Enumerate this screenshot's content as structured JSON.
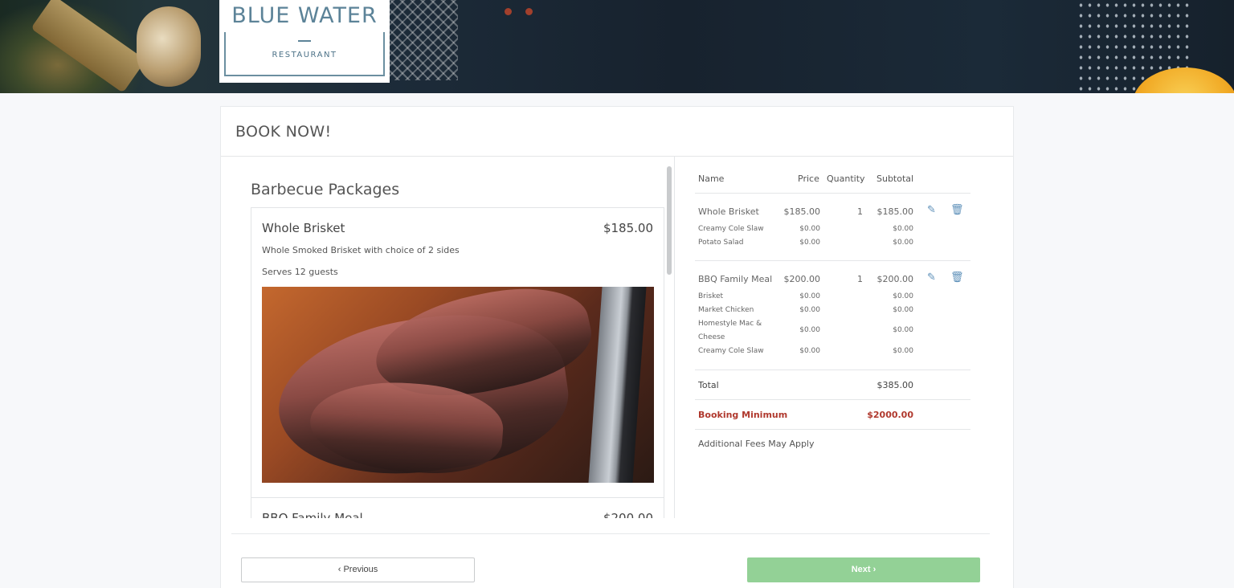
{
  "brand": {
    "logo_title": "BLUE WATER",
    "logo_subtitle": "RESTAURANT"
  },
  "page": {
    "title": "BOOK NOW!"
  },
  "menu": {
    "section_title": "Barbecue Packages",
    "packages": [
      {
        "name": "Whole Brisket",
        "price": "$185.00",
        "description": "Whole Smoked Brisket with choice of 2 sides",
        "serves": "Serves 12 guests",
        "image": "brisket-photo"
      },
      {
        "name": "BBQ Family Meal",
        "price": "$200.00"
      }
    ]
  },
  "cart": {
    "headers": {
      "name": "Name",
      "price": "Price",
      "quantity": "Quantity",
      "subtotal": "Subtotal"
    },
    "items": [
      {
        "name": "Whole Brisket",
        "price": "$185.00",
        "quantity": "1",
        "subtotal": "$185.00",
        "options": [
          {
            "name": "Creamy Cole Slaw",
            "price": "$0.00",
            "subtotal": "$0.00"
          },
          {
            "name": "Potato Salad",
            "price": "$0.00",
            "subtotal": "$0.00"
          }
        ]
      },
      {
        "name": "BBQ Family Meal",
        "price": "$200.00",
        "quantity": "1",
        "subtotal": "$200.00",
        "options": [
          {
            "name": "Brisket",
            "price": "$0.00",
            "subtotal": "$0.00"
          },
          {
            "name": "Market Chicken",
            "price": "$0.00",
            "subtotal": "$0.00"
          },
          {
            "name": "Homestyle Mac & Cheese",
            "price": "$0.00",
            "subtotal": "$0.00"
          },
          {
            "name": "Creamy Cole Slaw",
            "price": "$0.00",
            "subtotal": "$0.00"
          }
        ]
      }
    ],
    "total_label": "Total",
    "total_value": "$385.00",
    "minimum_label": "Booking Minimum",
    "minimum_value": "$2000.00",
    "fees_note": "Additional Fees May Apply",
    "edit_icon": "pencil-icon",
    "delete_icon": "trash-icon"
  },
  "nav": {
    "previous_label": "Previous",
    "next_label": "Next"
  },
  "colors": {
    "accent_blue": "#5c8fb8",
    "minimum_red": "#b0392e",
    "next_button": "#93d196"
  }
}
